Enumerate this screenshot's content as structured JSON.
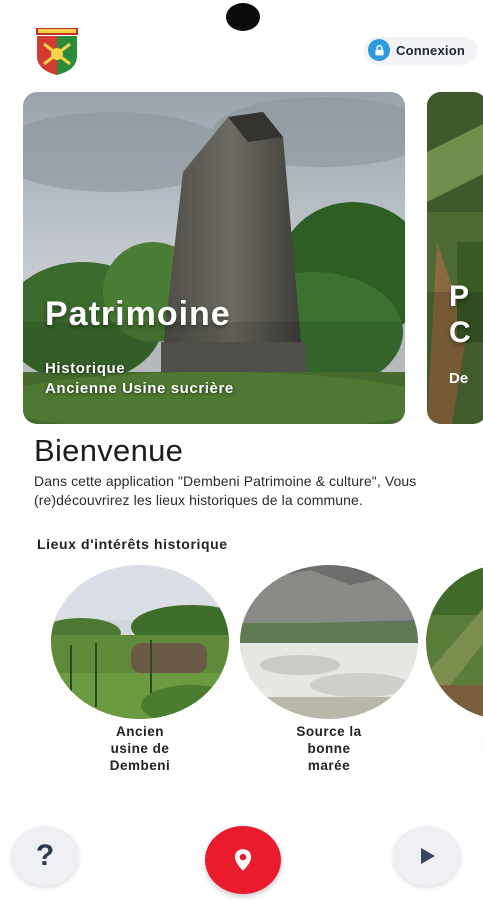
{
  "header": {
    "logo_icon": "crest-icon",
    "login_label": "Connexion",
    "login_icon": "lock-icon",
    "accent": "#2e9be0"
  },
  "carousel": {
    "cards": [
      {
        "title": "Patrimoine",
        "lines": [
          "Historique",
          "Ancienne Usine sucrière"
        ]
      },
      {
        "title": "P",
        "title2": "C",
        "subtitle_fragment": "De"
      }
    ]
  },
  "welcome": {
    "title": "Bienvenue",
    "text": "Dans cette application \"Dembeni Patrimoine & culture\", Vous (re)découvrirez les lieux historiques de la commune."
  },
  "poi_section": {
    "title": "Lieux d'intérêts historique",
    "items": [
      {
        "label_lines": [
          "Ancien",
          "usine de",
          "Dembeni"
        ]
      },
      {
        "label_lines": [
          "Source la",
          "bonne",
          "marée"
        ]
      },
      {
        "label_lines": [
          "l"
        ]
      }
    ]
  },
  "bottom_bar": {
    "help_icon": "question-mark-icon",
    "help_glyph": "?",
    "map_icon": "map-pin-icon",
    "play_icon": "play-icon",
    "map_color": "#ea1b2d"
  }
}
